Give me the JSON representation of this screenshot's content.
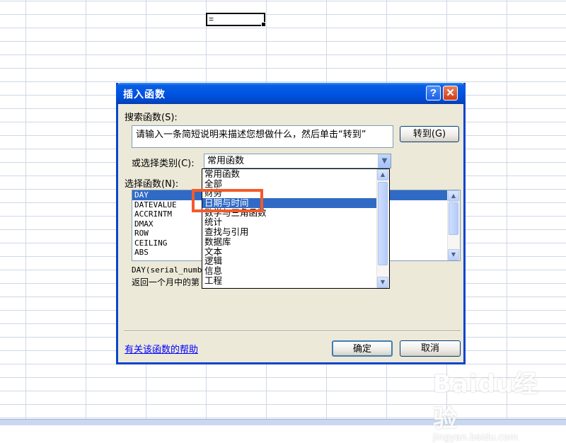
{
  "sheet": {
    "active_cell_value": "="
  },
  "dialog": {
    "title": "插入函数",
    "help_icon": "?",
    "close_icon": "✕",
    "search_label": "搜索函数(S):",
    "search_value": "请输入一条简短说明来描述您想做什么，然后单击“转到”",
    "goto_button": "转到(G)",
    "category_label": "或选择类别(C):",
    "category_selected": "常用函数",
    "select_function_label": "选择函数(N):",
    "functions": [
      "DAY",
      "DATEVALUE",
      "ACCRINTM",
      "DMAX",
      "ROW",
      "CEILING",
      "ABS"
    ],
    "selected_function": "DAY",
    "syntax": "DAY(serial_numb",
    "description": "返回一个月中的第",
    "help_link": "有关该函数的帮助",
    "ok_button": "确定",
    "cancel_button": "取消"
  },
  "dropdown": {
    "items": [
      "常用函数",
      "全部",
      "财务",
      "日期与时间",
      "数学与三角函数",
      "统计",
      "查找与引用",
      "数据库",
      "文本",
      "逻辑",
      "信息",
      "工程"
    ],
    "selected": "日期与时间"
  },
  "watermark": {
    "logo": "Baidu经验",
    "sub": "jingyan.baidu.com"
  }
}
